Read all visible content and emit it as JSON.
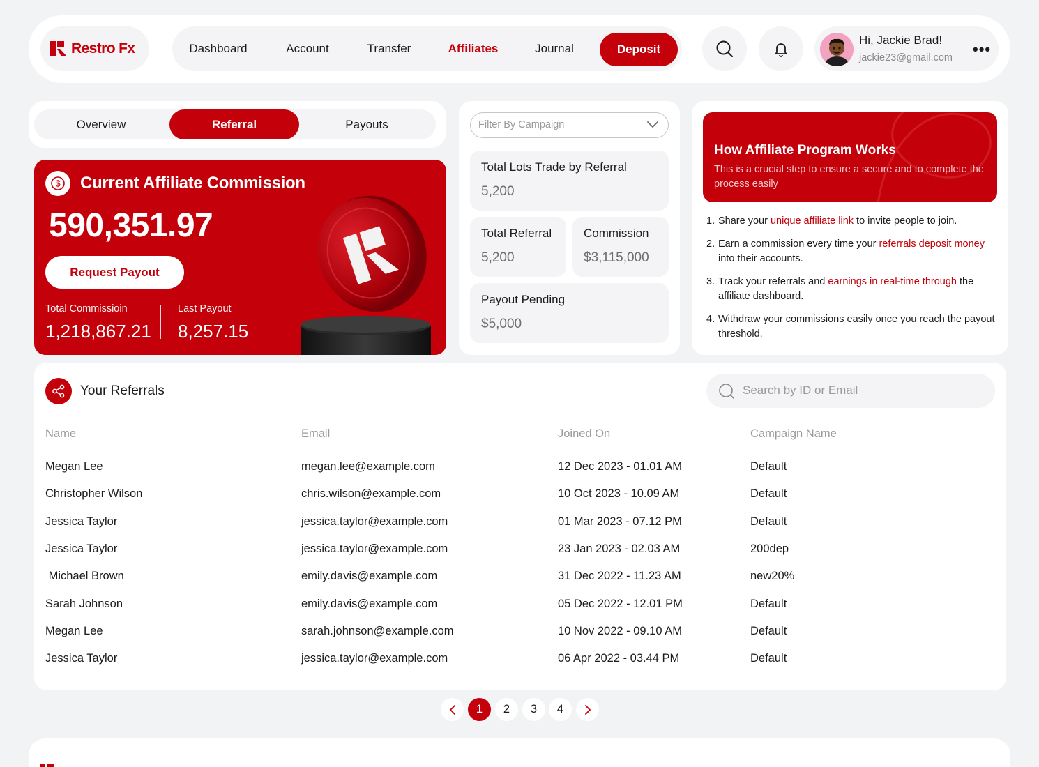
{
  "brand": {
    "name": "Restro Fx",
    "accent": "#c4000a"
  },
  "nav": {
    "items": [
      "Dashboard",
      "Account",
      "Transfer",
      "Affiliates",
      "Journal"
    ],
    "active": "Affiliates",
    "deposit": "Deposit"
  },
  "user": {
    "greeting": "Hi, Jackie Brad!",
    "email": "jackie23@gmail.com"
  },
  "tabs": {
    "items": [
      "Overview",
      "Referral",
      "Payouts"
    ],
    "active": "Referral"
  },
  "commission": {
    "title": "Current Affiliate Commission",
    "value": "590,351.97",
    "button": "Request Payout",
    "total_label": "Total Commissioin",
    "total_value": "1,218,867.21",
    "last_label": "Last Payout",
    "last_value": "8,257.15"
  },
  "stats": {
    "filter_placeholder": "Filter By Campaign",
    "lots_label": "Total Lots Trade by Referral",
    "lots_value": "5,200",
    "referral_label": "Total Referral",
    "referral_value": "5,200",
    "commission_label": "Commission",
    "commission_value": "$3,115,000",
    "pending_label": "Payout Pending",
    "pending_value": "$5,000"
  },
  "how": {
    "title": "How Affiliate Program Works",
    "subtitle": "This is a crucial step to ensure a secure and to complete the process easily",
    "steps": [
      {
        "num": "1.",
        "parts": [
          {
            "t": "Share your ",
            "h": false
          },
          {
            "t": "unique affiliate link",
            "h": true
          },
          {
            "t": " to invite people to join.",
            "h": false
          }
        ]
      },
      {
        "num": "2.",
        "parts": [
          {
            "t": "Earn a commission every time your ",
            "h": false
          },
          {
            "t": "referrals deposit money",
            "h": true
          },
          {
            "t": " into their accounts.",
            "h": false
          }
        ]
      },
      {
        "num": "3.",
        "parts": [
          {
            "t": "Track your referrals and ",
            "h": false
          },
          {
            "t": "earnings in real-time through",
            "h": true
          },
          {
            "t": " the affiliate dashboard.",
            "h": false
          }
        ]
      },
      {
        "num": "4.",
        "parts": [
          {
            "t": "Withdraw your commissions easily once you reach the payout threshold.",
            "h": false
          }
        ]
      }
    ]
  },
  "referrals": {
    "title": "Your Referrals",
    "search_placeholder": "Search by ID or Email",
    "columns": [
      "Name",
      "Email",
      "Joined On",
      "Campaign Name"
    ],
    "rows": [
      [
        "Megan Lee",
        "megan.lee@example.com",
        "12 Dec 2023 - 01.01 AM",
        "Default"
      ],
      [
        "Christopher Wilson",
        "chris.wilson@example.com",
        "10 Oct 2023 - 10.09 AM",
        "Default"
      ],
      [
        "Jessica Taylor",
        "jessica.taylor@example.com",
        "01 Mar 2023 - 07.12 PM",
        "Default"
      ],
      [
        "Jessica Taylor",
        "jessica.taylor@example.com",
        "23 Jan 2023 - 02.03 AM",
        "200dep"
      ],
      [
        " Michael Brown",
        "emily.davis@example.com",
        "31 Dec 2022 - 11.23 AM",
        "new20%"
      ],
      [
        "Sarah Johnson",
        "emily.davis@example.com",
        "05 Dec 2022 - 12.01 PM",
        "Default"
      ],
      [
        "Megan Lee",
        "sarah.johnson@example.com",
        "10 Nov 2022 - 09.10 AM",
        "Default"
      ],
      [
        "Jessica Taylor",
        "jessica.taylor@example.com",
        "06 Apr 2022 - 03.44 PM",
        "Default"
      ]
    ]
  },
  "pagination": {
    "pages": [
      "1",
      "2",
      "3",
      "4"
    ],
    "current": "1"
  },
  "icons": {
    "search": "search-icon",
    "bell": "bell-icon",
    "more": "more-horizontal-icon",
    "dollar": "dollar-circle-icon",
    "share": "share-icon",
    "chevron_down": "chevron-down-icon",
    "prev": "chevron-left-icon",
    "next": "chevron-right-icon"
  }
}
